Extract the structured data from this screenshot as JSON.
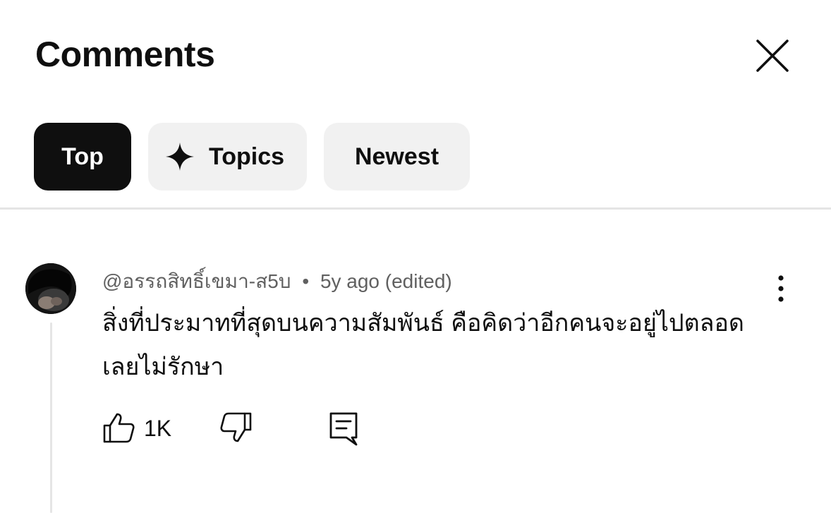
{
  "header": {
    "title": "Comments",
    "close_icon": "close-icon"
  },
  "filters": {
    "chips": [
      {
        "label": "Top",
        "active": true
      },
      {
        "label": "Topics",
        "icon": "sparkle-icon",
        "active": false
      },
      {
        "label": "Newest",
        "active": false
      }
    ]
  },
  "comment": {
    "author": "@อรรถสิทธิ์เขมา-ส5บ",
    "separator": "•",
    "time": "5y ago (edited)",
    "text": "สิ่งที่ประมาทที่สุดบนความสัมพันธ์ คือคิดว่าอีกคนจะอยู่ไปตลอดเลยไม่รักษา",
    "like_count": "1K",
    "icons": {
      "like": "thumbs-up-icon",
      "dislike": "thumbs-down-icon",
      "reply": "reply-icon",
      "more": "more-vert-icon"
    }
  },
  "colors": {
    "active_chip_bg": "#0f0f0f",
    "chip_bg": "#f1f1f1",
    "meta_text": "#606060",
    "divider": "#e5e5e5"
  }
}
